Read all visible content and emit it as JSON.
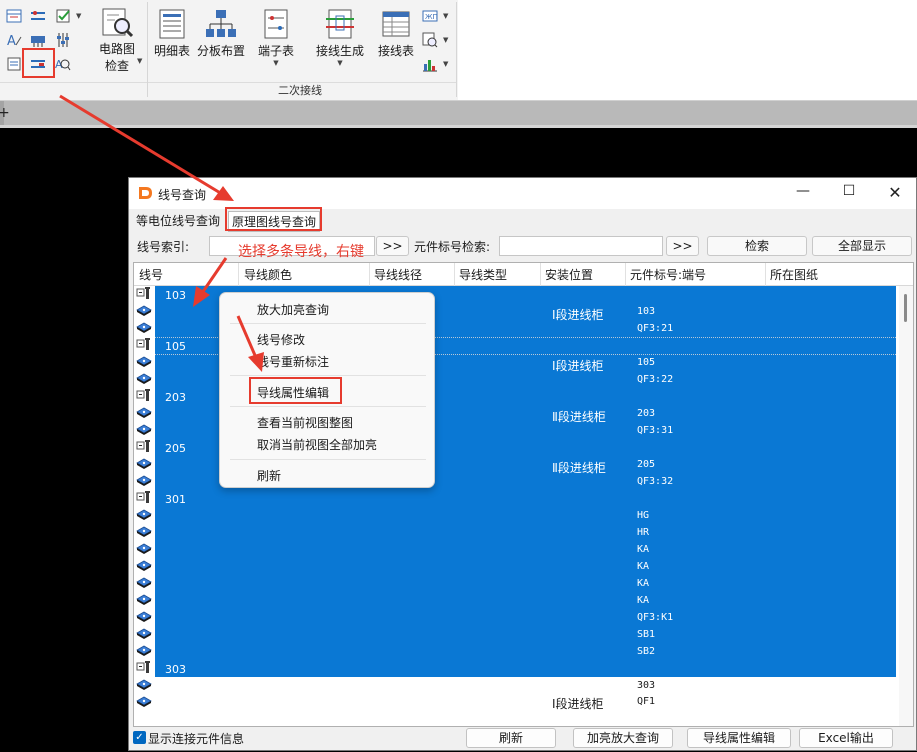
{
  "ribbon": {
    "circuit_check_label_1": "电路图",
    "circuit_check_label_2": "检查",
    "detail_table": "明细表",
    "panel_layout": "分板布置",
    "terminal_table": "端子表",
    "wire_generate": "接线生成",
    "wire_table": "接线表",
    "group_label": "二次接线"
  },
  "dialog": {
    "title": "线号查询",
    "tab_equipotential": "等电位线号查询",
    "tab_schematic": "原理图线号查询",
    "index_label": "线号索引:",
    "nav_next_1": ">>",
    "component_search_label": "元件标号检索:",
    "nav_next_2": ">>",
    "search_button": "检索",
    "show_all_button": "全部显示"
  },
  "table": {
    "columns": [
      "线号",
      "导线颜色",
      "导线线径",
      "导线类型",
      "安装位置",
      "元件标号:端号",
      "所在图纸"
    ],
    "wire_numbers": [
      "103",
      "105",
      "203",
      "205",
      "301",
      "303"
    ],
    "locations": [
      "Ⅰ段进线柜",
      "Ⅰ段进线柜",
      "Ⅱ段进线柜",
      "Ⅱ段进线柜",
      "Ⅰ段进线柜"
    ],
    "terminals": [
      "103",
      "QF3:21",
      "105",
      "QF3:22",
      "203",
      "QF3:31",
      "205",
      "QF3:32",
      "HG",
      "HR",
      "KA",
      "KA",
      "KA",
      "KA",
      "QF3:K1",
      "SB1",
      "SB2",
      "303",
      "QF1"
    ]
  },
  "context_menu": {
    "items": [
      "放大加亮查询",
      "线号修改",
      "线号重新标注",
      "导线属性编辑",
      "查看当前视图整图",
      "取消当前视图全部加亮",
      "刷新"
    ]
  },
  "annotation": "选择多条导线，右键",
  "footer": {
    "show_info_label": "显示连接元件信息",
    "refresh_button": "刷新",
    "highlight_button": "加亮放大查询",
    "edit_button": "导线属性编辑",
    "excel_button": "Excel输出"
  },
  "colors": {
    "selection": "#0a78d4",
    "annotation": "#e63b2e",
    "accent": "#0067c0"
  }
}
